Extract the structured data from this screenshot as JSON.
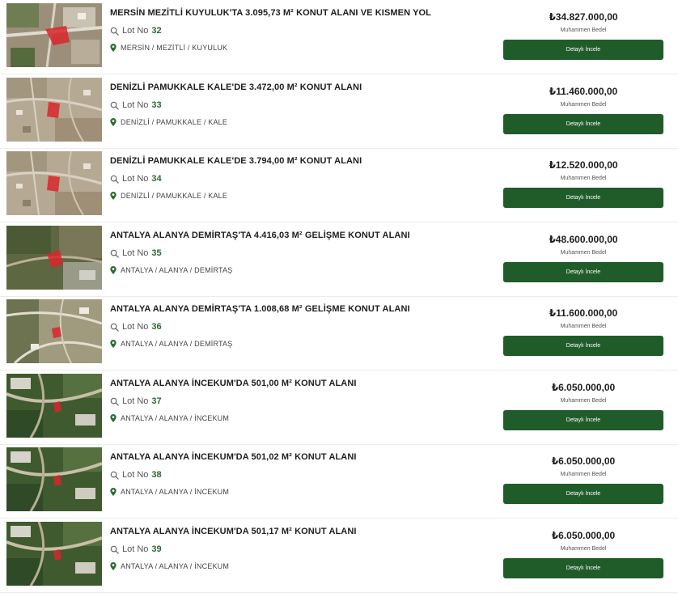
{
  "listings": [
    {
      "title": "MERSİN MEZİTLİ KUYULUK'TA 3.095,73 M² KONUT ALANI VE KISMEN YOL",
      "lot_label": "Lot No",
      "lot_number": "32",
      "location": "MERSİN / MEZİTLİ / KUYULUK",
      "price": "₺34.827.000,00",
      "estimate_label": "Muhammen Bedel",
      "button_label": "Detaylı İncele",
      "thumb_variant": "urban"
    },
    {
      "title": "DENİZLİ PAMUKKALE KALE'DE 3.472,00 M² KONUT ALANI",
      "lot_label": "Lot No",
      "lot_number": "33",
      "location": "DENİZLİ / PAMUKKALE / KALE",
      "price": "₺11.460.000,00",
      "estimate_label": "Muhammen Bedel",
      "button_label": "Detaylı İncele",
      "thumb_variant": "town"
    },
    {
      "title": "DENİZLİ PAMUKKALE KALE'DE 3.794,00 M² KONUT ALANI",
      "lot_label": "Lot No",
      "lot_number": "34",
      "location": "DENİZLİ / PAMUKKALE / KALE",
      "price": "₺12.520.000,00",
      "estimate_label": "Muhammen Bedel",
      "button_label": "Detaylı İncele",
      "thumb_variant": "town"
    },
    {
      "title": "ANTALYA ALANYA DEMİRTAŞ'TA 4.416,03 M² GELİŞME KONUT ALANI",
      "lot_label": "Lot No",
      "lot_number": "35",
      "location": "ANTALYA / ALANYA / DEMİRTAŞ",
      "price": "₺48.600.000,00",
      "estimate_label": "Muhammen Bedel",
      "button_label": "Detaylı İncele",
      "thumb_variant": "rural"
    },
    {
      "title": "ANTALYA ALANYA DEMİRTAŞ'TA 1.008,68 M² GELİŞME KONUT ALANI",
      "lot_label": "Lot No",
      "lot_number": "36",
      "location": "ANTALYA / ALANYA / DEMİRTAŞ",
      "price": "₺11.600.000,00",
      "estimate_label": "Muhammen Bedel",
      "button_label": "Detaylı İncele",
      "thumb_variant": "roads"
    },
    {
      "title": "ANTALYA ALANYA İNCEKUM'DA 501,00 M² KONUT ALANI",
      "lot_label": "Lot No",
      "lot_number": "37",
      "location": "ANTALYA / ALANYA / İNCEKUM",
      "price": "₺6.050.000,00",
      "estimate_label": "Muhammen Bedel",
      "button_label": "Detaylı İncele",
      "thumb_variant": "green"
    },
    {
      "title": "ANTALYA ALANYA İNCEKUM'DA 501,02 M² KONUT ALANI",
      "lot_label": "Lot No",
      "lot_number": "38",
      "location": "ANTALYA / ALANYA / İNCEKUM",
      "price": "₺6.050.000,00",
      "estimate_label": "Muhammen Bedel",
      "button_label": "Detaylı İncele",
      "thumb_variant": "green"
    },
    {
      "title": "ANTALYA ALANYA İNCEKUM'DA 501,17 M² KONUT ALANI",
      "lot_label": "Lot No",
      "lot_number": "39",
      "location": "ANTALYA / ALANYA / İNCEKUM",
      "price": "₺6.050.000,00",
      "estimate_label": "Muhammen Bedel",
      "button_label": "Detaylı İncele",
      "thumb_variant": "green"
    }
  ],
  "colors": {
    "accent": "#1f5c2a",
    "lot_number": "#2d6a34",
    "parcel_highlight": "#d9262b"
  },
  "icons": {
    "lot": "search-icon",
    "location": "map-pin-icon"
  }
}
